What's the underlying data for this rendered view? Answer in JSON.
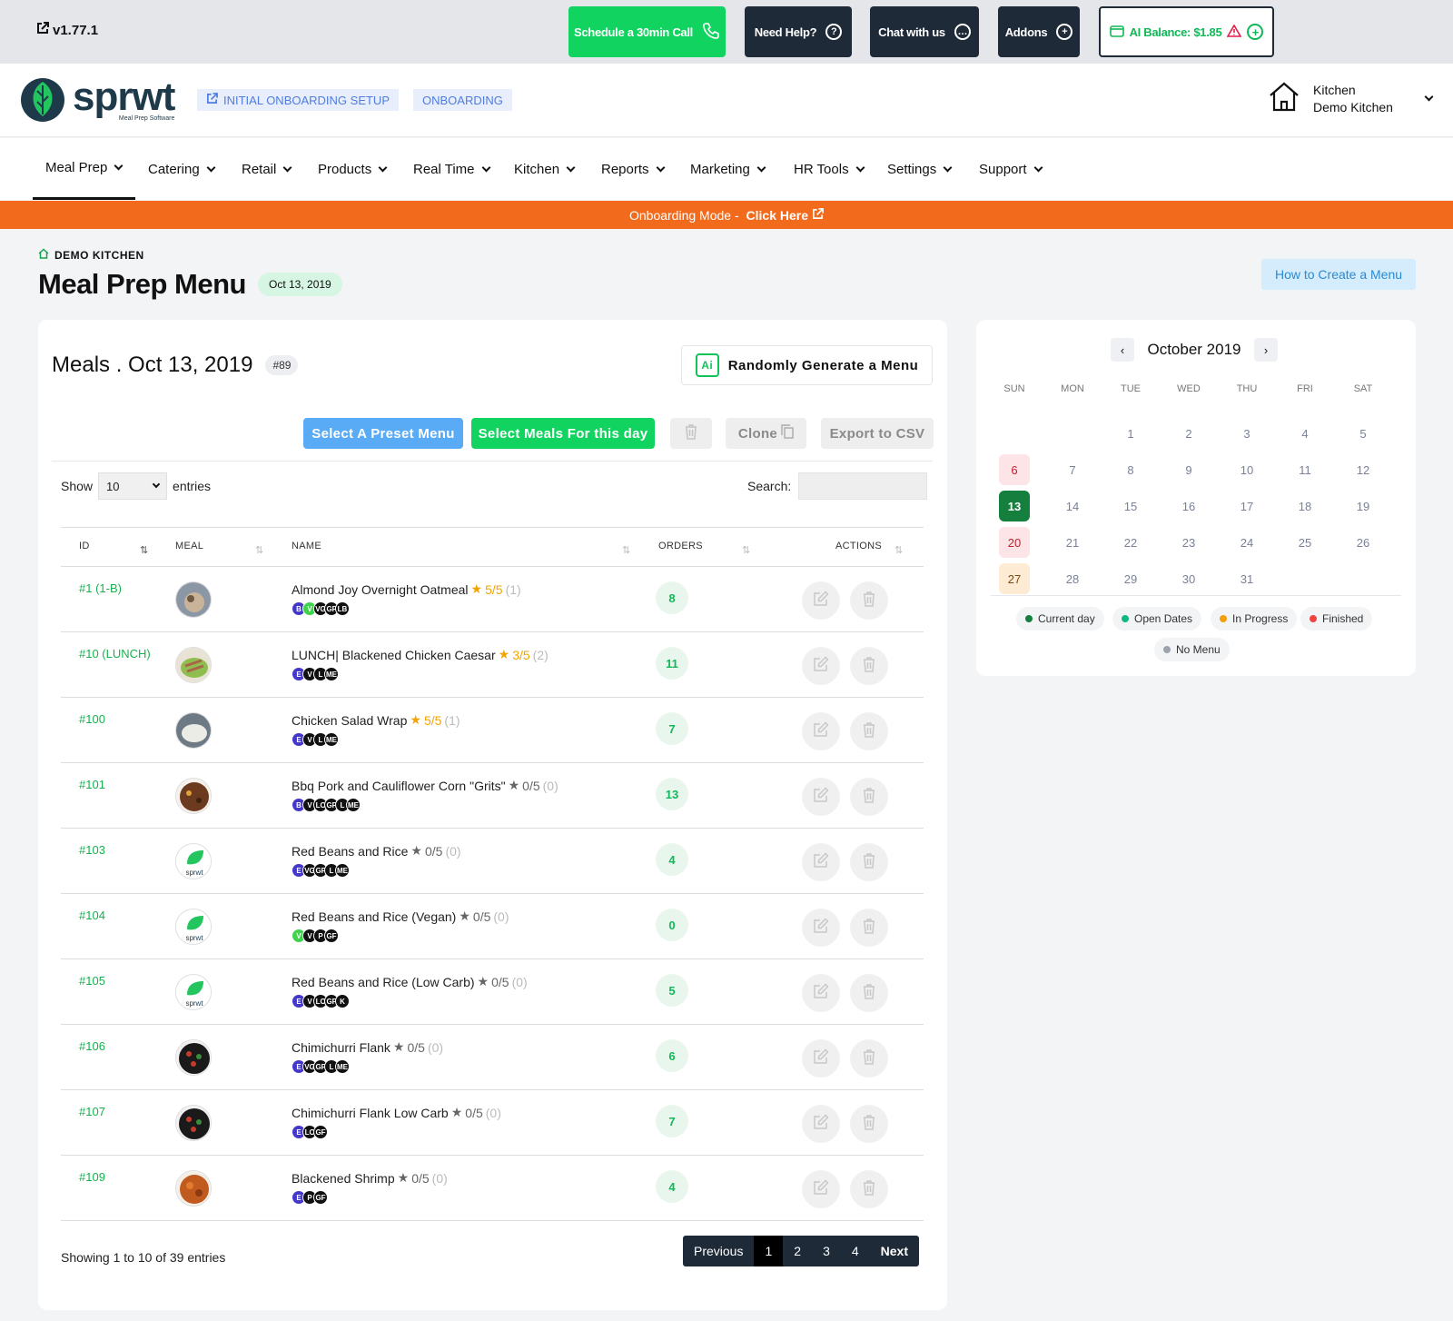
{
  "topbar": {
    "version": "v1.77.1",
    "schedule": "Schedule a 30min Call",
    "help": "Need Help?",
    "chat": "Chat with us",
    "addons": "Addons",
    "ai_balance": "AI Balance: $1.85"
  },
  "header": {
    "logo_text": "sprwt",
    "logo_sub": "Meal Prep Software",
    "pill_setup": "INITIAL ONBOARDING SETUP",
    "pill_onboarding": "ONBOARDING",
    "kitchen_label": "Kitchen",
    "kitchen_name": "Demo Kitchen"
  },
  "nav": [
    "Meal Prep",
    "Catering",
    "Retail",
    "Products",
    "Real Time",
    "Kitchen",
    "Reports",
    "Marketing",
    "HR Tools",
    "Settings",
    "Support"
  ],
  "banner": {
    "text": "Onboarding Mode - ",
    "link": "Click Here"
  },
  "page": {
    "crumb": "DEMO KITCHEN",
    "title": "Meal Prep Menu",
    "date_badge": "Oct 13, 2019",
    "howto": "How to Create a Menu"
  },
  "meals": {
    "title": "Meals . Oct 13, 2019",
    "number": "#89",
    "generate": "Randomly Generate a Menu",
    "preset": "Select A Preset Menu",
    "select_meals": "Select Meals For this day",
    "clone": "Clone",
    "export": "Export to CSV",
    "show": "Show",
    "entries_value": "10",
    "entries": "entries",
    "search": "Search:",
    "columns": [
      "ID",
      "MEAL",
      "NAME",
      "ORDERS",
      "ACTIONS"
    ],
    "rows": [
      {
        "id": "#1 (1-B)",
        "name": "Almond Joy Overnight Oatmeal",
        "rating": "5/5",
        "count": "(1)",
        "tags": [
          "B",
          "V",
          "VG",
          "GF",
          "LB"
        ],
        "orders": "8",
        "rated": true,
        "img": "oat"
      },
      {
        "id": "#10 (LUNCH)",
        "name": "LUNCH| Blackened Chicken Caesar",
        "rating": "3/5",
        "count": "(2)",
        "tags": [
          "E",
          "V",
          "L",
          "ME"
        ],
        "orders": "11",
        "rated": true,
        "img": "salad"
      },
      {
        "id": "#100",
        "name": "Chicken Salad Wrap",
        "rating": "5/5",
        "count": "(1)",
        "tags": [
          "E",
          "V",
          "L",
          "ME"
        ],
        "orders": "7",
        "rated": true,
        "img": "wrap"
      },
      {
        "id": "#101",
        "name": "Bbq Pork and Cauliflower Corn \"Grits\"",
        "rating": "0/5",
        "count": "(0)",
        "tags": [
          "B",
          "V",
          "LC",
          "GF",
          "L",
          "ME"
        ],
        "orders": "13",
        "rated": false,
        "img": "pork"
      },
      {
        "id": "#103",
        "name": "Red Beans and Rice",
        "rating": "0/5",
        "count": "(0)",
        "tags": [
          "E",
          "VG",
          "GF",
          "L",
          "ME"
        ],
        "orders": "4",
        "rated": false,
        "img": "logo"
      },
      {
        "id": "#104",
        "name": "Red Beans and Rice (Vegan)",
        "rating": "0/5",
        "count": "(0)",
        "tags": [
          "V",
          "V",
          "P",
          "GF"
        ],
        "orders": "0",
        "rated": false,
        "img": "logo"
      },
      {
        "id": "#105",
        "name": "Red Beans and Rice (Low Carb)",
        "rating": "0/5",
        "count": "(0)",
        "tags": [
          "E",
          "V",
          "LC",
          "GF",
          "K"
        ],
        "orders": "5",
        "rated": false,
        "img": "logo"
      },
      {
        "id": "#106",
        "name": "Chimichurri Flank",
        "rating": "0/5",
        "count": "(0)",
        "tags": [
          "E",
          "VG",
          "GF",
          "L",
          "ME"
        ],
        "orders": "6",
        "rated": false,
        "img": "flank"
      },
      {
        "id": "#107",
        "name": "Chimichurri Flank Low Carb",
        "rating": "0/5",
        "count": "(0)",
        "tags": [
          "E",
          "LC",
          "GF"
        ],
        "orders": "7",
        "rated": false,
        "img": "flank"
      },
      {
        "id": "#109",
        "name": "Blackened Shrimp",
        "rating": "0/5",
        "count": "(0)",
        "tags": [
          "E",
          "P",
          "GF"
        ],
        "orders": "4",
        "rated": false,
        "img": "shrimp"
      }
    ],
    "showing": "Showing 1 to 10 of 39 entries",
    "pager": {
      "prev": "Previous",
      "pages": [
        "1",
        "2",
        "3",
        "4"
      ],
      "next": "Next"
    }
  },
  "calendar": {
    "title": "October 2019",
    "dow": [
      "SUN",
      "MON",
      "TUE",
      "WED",
      "THU",
      "FRI",
      "SAT"
    ],
    "days": [
      "1",
      "2",
      "3",
      "4",
      "5",
      "6",
      "7",
      "8",
      "9",
      "10",
      "11",
      "12",
      "13",
      "14",
      "15",
      "16",
      "17",
      "18",
      "19",
      "20",
      "21",
      "22",
      "23",
      "24",
      "25",
      "26",
      "27",
      "28",
      "29",
      "30",
      "31"
    ],
    "legend": [
      "Current day",
      "Open Dates",
      "In Progress",
      "Finished",
      "No Menu"
    ],
    "colors": {
      "current": "#15803d",
      "open": "#10b981",
      "progress": "#f59e0b",
      "finished": "#ef4444",
      "none": "#9ca3af"
    }
  }
}
